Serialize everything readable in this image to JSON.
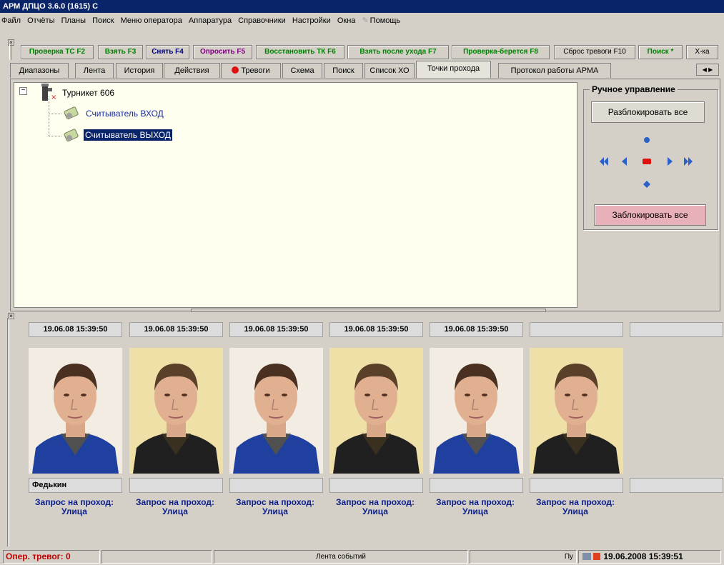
{
  "window": {
    "title": "АРМ ДПЦО  3.6.0 (1615) С"
  },
  "menu": [
    "Файл",
    "Отчёты",
    "Планы",
    "Поиск",
    "Меню оператора",
    "Аппаратура",
    "Справочники",
    "Настройки",
    "Окна",
    "Помощь"
  ],
  "toolbar": [
    {
      "label": "Проверка ТС F2",
      "color": "#008000"
    },
    {
      "label": "Взять F3",
      "color": "#008000"
    },
    {
      "label": "Снять F4",
      "color": "#000080"
    },
    {
      "label": "Опросить F5",
      "color": "#800080"
    },
    {
      "label": "Восстановить ТК F6",
      "color": "#008000"
    },
    {
      "label": "Взять после ухода F7",
      "color": "#008000"
    },
    {
      "label": "Проверка-берется F8",
      "color": "#008000"
    },
    {
      "label": "Сброс тревоги F10",
      "color": "#000000"
    },
    {
      "label": "Поиск *",
      "color": "#008000"
    },
    {
      "label": "Х-ка",
      "color": "#000000"
    }
  ],
  "tabs": [
    "Диапазоны",
    "Лента",
    "История",
    "Действия",
    "Тревоги",
    "Схема",
    "Поиск",
    "Список ХО",
    "Точки прохода",
    "Протокол работы АРМА"
  ],
  "active_tab": "Точки прохода",
  "tree": {
    "root": "Турникет 606",
    "children": [
      "Считыватель ВХОД",
      "Считыватель ВЫХОД"
    ],
    "selected": "Считыватель ВЫХОД"
  },
  "manual": {
    "title": "Ручное управление",
    "unlock_all": "Разблокировать все",
    "lock_all": "Заблокировать все"
  },
  "events": [
    {
      "time": "19.06.08 15:39:50",
      "name": "Федькин",
      "request": "Запрос на проход: Улица",
      "person": "a"
    },
    {
      "time": "19.06.08 15:39:50",
      "name": "",
      "request": "Запрос на проход: Улица",
      "person": "b"
    },
    {
      "time": "19.06.08 15:39:50",
      "name": "",
      "request": "Запрос на проход: Улица",
      "person": "a"
    },
    {
      "time": "19.06.08 15:39:50",
      "name": "",
      "request": "Запрос на проход: Улица",
      "person": "b"
    },
    {
      "time": "19.06.08 15:39:50",
      "name": "",
      "request": "Запрос на проход: Улица",
      "person": "a"
    },
    {
      "time": "",
      "name": "",
      "request": "Запрос на проход: Улица",
      "person": "b"
    },
    {
      "time": "",
      "name": "",
      "request": "",
      "person": ""
    }
  ],
  "status": {
    "alarms": "Опер. тревог: 0",
    "feed": "Лента событий",
    "mode": "Пу",
    "datetime": "19.06.2008 15:39:51"
  }
}
